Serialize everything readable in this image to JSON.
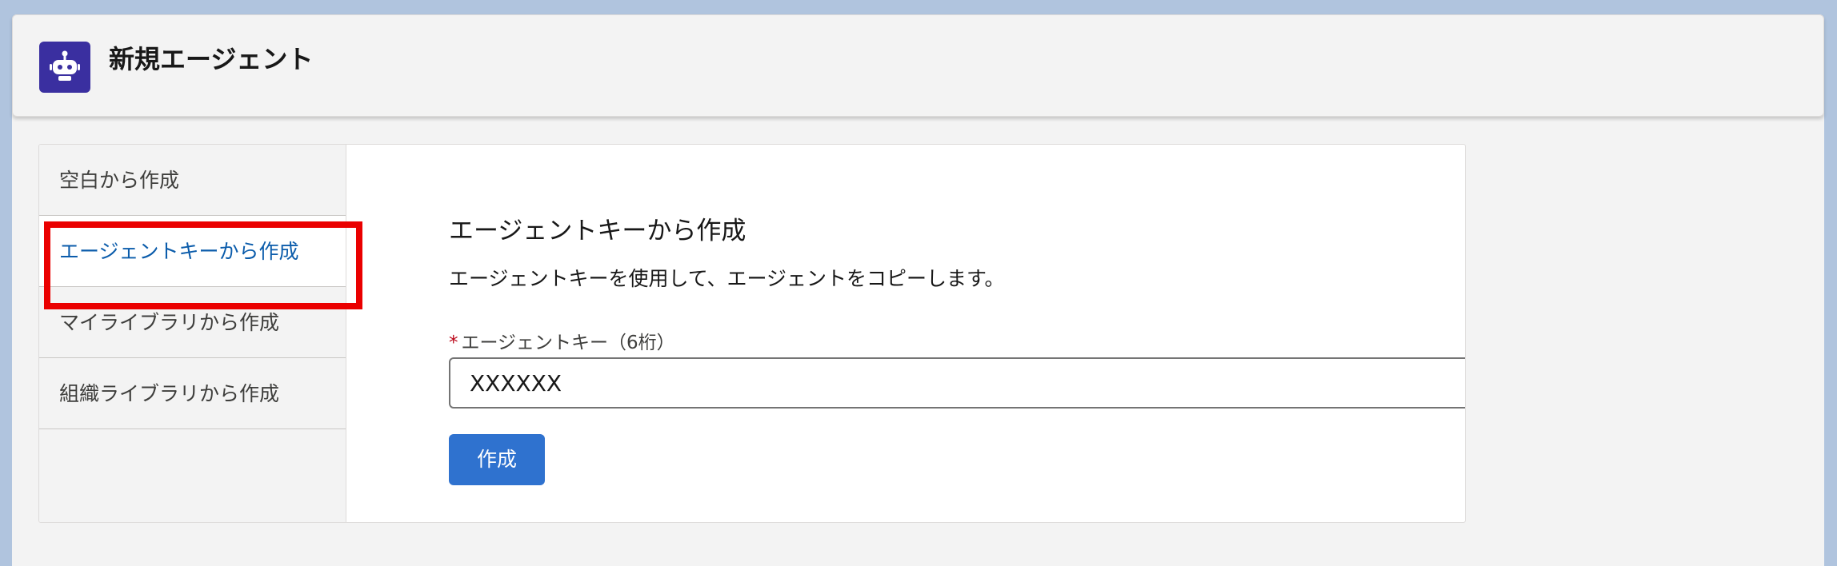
{
  "header": {
    "title": "新規エージェント",
    "icon": "robot-icon",
    "icon_color": "#3a2fa0"
  },
  "nav": {
    "items": [
      {
        "label": "空白から作成",
        "active": false
      },
      {
        "label": "エージェントキーから作成",
        "active": true
      },
      {
        "label": "マイライブラリから作成",
        "active": false
      },
      {
        "label": "組織ライブラリから作成",
        "active": false
      }
    ]
  },
  "content": {
    "title": "エージェントキーから作成",
    "description": "エージェントキーを使用して、エージェントをコピーします。",
    "field": {
      "required_mark": "*",
      "label": "エージェントキー（6桁）",
      "value": "XXXXXX"
    },
    "submit_label": "作成"
  },
  "colors": {
    "accent": "#2f72cf",
    "active_nav_text": "#0b5cab",
    "highlight": "#ea0000",
    "required": "#ba0517"
  }
}
